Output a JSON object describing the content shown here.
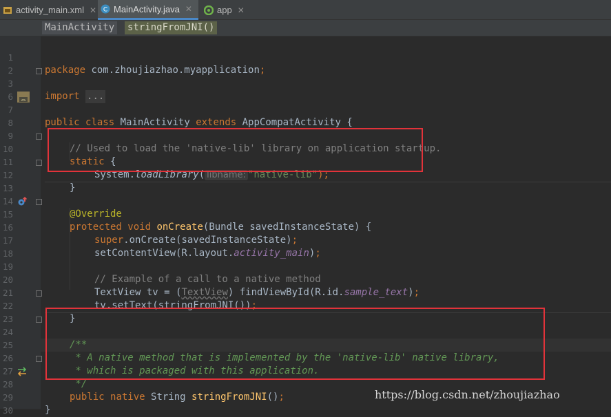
{
  "tabs": [
    {
      "label": "activity_main.xml",
      "icon": "xml-file-icon"
    },
    {
      "label": "MainActivity.java",
      "icon": "java-class-icon",
      "active": true
    },
    {
      "label": "app",
      "icon": "android-module-icon"
    }
  ],
  "breadcrumbs": [
    "MainActivity",
    "stringFromJNI()"
  ],
  "editor": {
    "line_numbers": [
      "1",
      "2",
      "3",
      "6",
      "7",
      "8",
      "9",
      "10",
      "11",
      "12",
      "13",
      "14",
      "15",
      "16",
      "17",
      "18",
      "19",
      "20",
      "21",
      "22",
      "23",
      "24",
      "25",
      "26",
      "27",
      "28",
      "29",
      "30"
    ],
    "line1": {
      "kw": "package",
      "rest": " com.zhoujiazhao.myapplication",
      "semi": ";"
    },
    "line3": {
      "kw": "import",
      "fold": "..."
    },
    "line7": {
      "kw1": "public",
      "kw2": "class",
      "name": " MainActivity ",
      "kw3": "extends",
      "rest": " AppCompatActivity {"
    },
    "line9": {
      "comment": "// Used to load the 'native-lib' library on application startup."
    },
    "line10": {
      "kw": "static",
      "rest": " {"
    },
    "line11": {
      "pre": "System.",
      "method": "loadLibrary",
      "open": "(",
      "hint": "libname:",
      "str": "\"native-lib\"",
      "close": ");"
    },
    "line12": {
      "text": "}"
    },
    "line14": {
      "ann": "@Override"
    },
    "line15": {
      "kw1": "protected",
      "kw2": "void",
      "fn": "onCreate",
      "rest": "(Bundle savedInstanceState) {"
    },
    "line16": {
      "kw": "super",
      "rest": ".onCreate(savedInstanceState)",
      "semi": ";"
    },
    "line17": {
      "pre": "setContentView(R.layout.",
      "field": "activity_main",
      "post": ")",
      "semi": ";"
    },
    "line19": {
      "comment": "// Example of a call to a native method"
    },
    "line20": {
      "pre": "TextView tv = (",
      "cast": "TextView",
      "mid": ") findViewById(R.id.",
      "field": "sample_text",
      "post": ")",
      "semi": ";"
    },
    "line21": {
      "pre": "tv.setText(stringFromJNI())",
      "semi": ";"
    },
    "line22": {
      "text": "}"
    },
    "line24": {
      "doc": "/**"
    },
    "line25": {
      "doc": " * A native method that is implemented by the 'native-lib' native library,"
    },
    "line26": {
      "doc": " * which is packaged with this application."
    },
    "line27": {
      "doc": " */"
    },
    "line28": {
      "kw1": "public",
      "kw2": "native",
      "mid": " String ",
      "fn": "stringFromJNI",
      "rest": "()",
      "semi": ";"
    },
    "line29": {
      "text": "}"
    }
  },
  "watermark": "https://blog.csdn.net/zhoujiazhao",
  "colors": {
    "highlight_box": "#E2333A",
    "keyword": "#CC7832",
    "string": "#6A8759",
    "function": "#FFC66D",
    "annotation": "#BBB529"
  }
}
